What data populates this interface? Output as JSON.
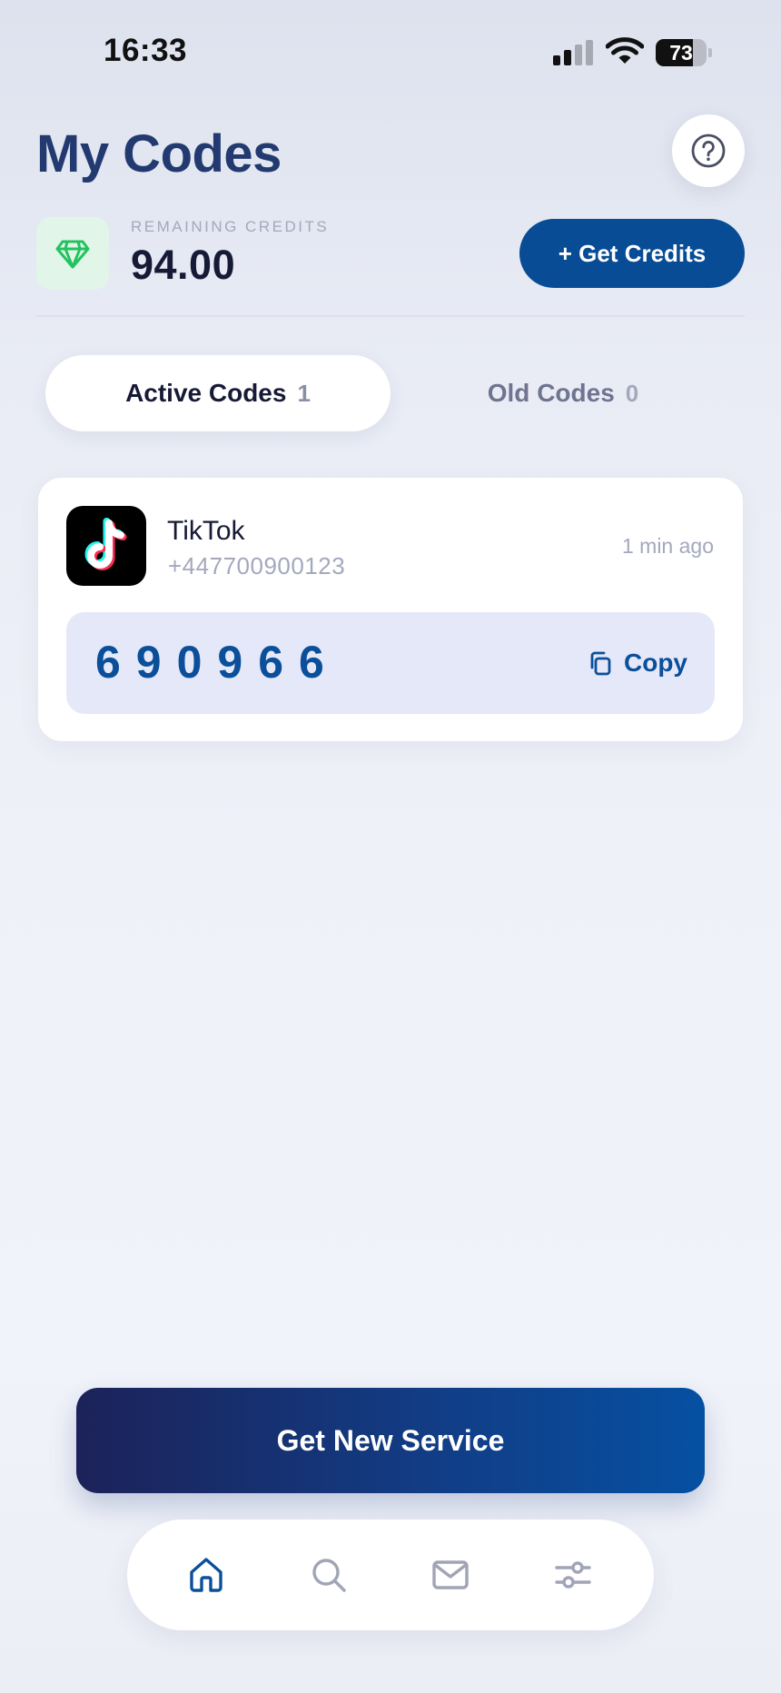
{
  "status_bar": {
    "time": "16:33",
    "battery": "73",
    "battery_level": 0.73,
    "signal_bars": 2,
    "icons": [
      "cellular-signal-icon",
      "wifi-icon",
      "battery-icon"
    ]
  },
  "header": {
    "title": "My Codes",
    "help_icon": "question-circle-icon"
  },
  "credits": {
    "label": "REMAINING CREDITS",
    "value": "94.00",
    "icon": "diamond-icon",
    "get_credits_label": "+ Get Credits"
  },
  "tabs": [
    {
      "label": "Active Codes",
      "count": "1",
      "active": true
    },
    {
      "label": "Old Codes",
      "count": "0",
      "active": false
    }
  ],
  "codes": [
    {
      "service": "TikTok",
      "service_icon": "tiktok-logo-icon",
      "phone": "+447700900123",
      "time": "1 min ago",
      "code": "690966",
      "copy_label": "Copy",
      "copy_icon": "copy-icon"
    }
  ],
  "actions": {
    "new_service_label": "Get New Service"
  },
  "bottom_nav": [
    {
      "name": "home",
      "icon": "home-icon",
      "active": true
    },
    {
      "name": "search",
      "icon": "search-icon",
      "active": false
    },
    {
      "name": "messages",
      "icon": "mail-icon",
      "active": false
    },
    {
      "name": "settings",
      "icon": "sliders-icon",
      "active": false
    }
  ],
  "colors": {
    "primary": "#084c95",
    "title": "#223a70",
    "code": "#0b4f9a",
    "credits_icon": "#22c35e",
    "background": "#eff1f9"
  }
}
